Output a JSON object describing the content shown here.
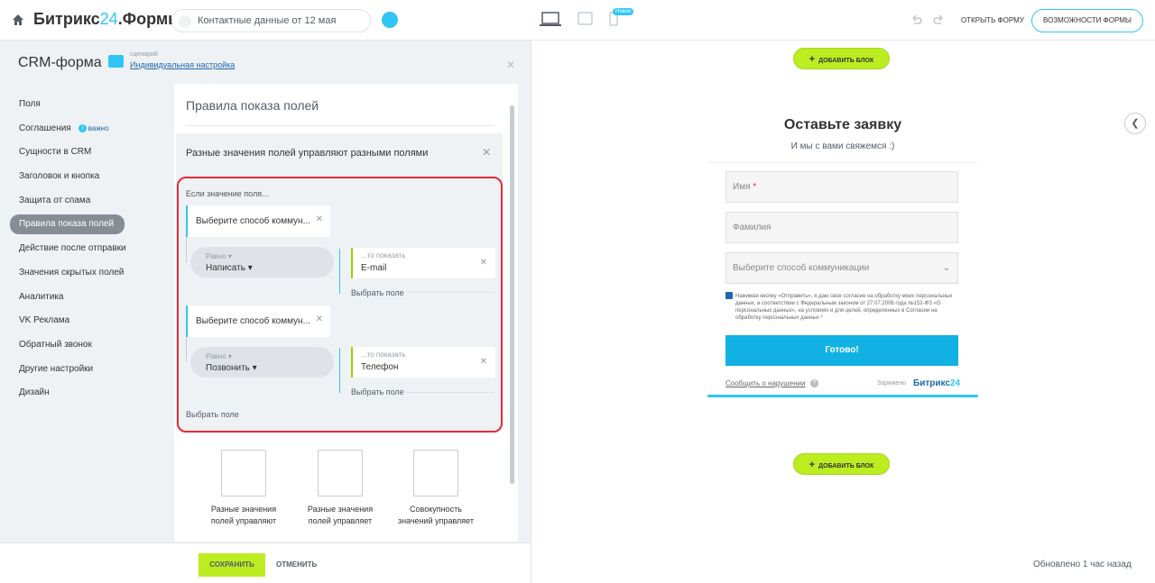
{
  "header": {
    "logo_main": "Битрикс",
    "logo_num": "24",
    "logo_suffix": ".Формы",
    "doc_name": "Контактные данные от 12 мая",
    "new_badge": "Новое",
    "open_form": "ОТКРЫТЬ ФОРМУ",
    "features": "ВОЗМОЖНОСТИ ФОРМЫ"
  },
  "sidebar": {
    "title": "CRM-форма",
    "scenario_label": "сценарий",
    "scenario_value": "Индивидуальная настройка",
    "items": [
      {
        "label": "Поля"
      },
      {
        "label": "Соглашения",
        "badge": "важно"
      },
      {
        "label": "Сущности в CRM"
      },
      {
        "label": "Заголовок и кнопка"
      },
      {
        "label": "Защита от спама"
      },
      {
        "label": "Правила показа полей",
        "active": true
      },
      {
        "label": "Действие после отправки"
      },
      {
        "label": "Значения скрытых полей"
      },
      {
        "label": "Аналитика"
      },
      {
        "label": "VK Реклама"
      },
      {
        "label": "Обратный звонок"
      },
      {
        "label": "Другие настройки"
      },
      {
        "label": "Дизайн"
      }
    ]
  },
  "rules": {
    "title": "Правила показа полей",
    "card_title": "Разные значения полей управляют разными полями",
    "condition_label": "Если значение поля...",
    "rules": [
      {
        "field": "Выберите способ коммун...",
        "eq_label": "Равно",
        "eq_value": "Написать",
        "show_label": "...то показать",
        "show_value": "E-mail",
        "pick": "Выбрать поле"
      },
      {
        "field": "Выберите способ коммун...",
        "eq_label": "Равно",
        "eq_value": "Позвонить",
        "show_label": "...то показать",
        "show_value": "Телефон",
        "pick": "Выбрать поле"
      }
    ],
    "pick_field": "Выбрать поле",
    "options": [
      {
        "line1": "Разные значения",
        "line2": "полей управляют"
      },
      {
        "line1": "Разные значения",
        "line2": "полей управляет"
      },
      {
        "line1": "Совокупность",
        "line2": "значений управляет"
      }
    ]
  },
  "footer": {
    "save": "СОХРАНИТЬ",
    "cancel": "ОТМЕНИТЬ"
  },
  "preview": {
    "add_block": "ДОБАВИТЬ БЛОК",
    "form_title": "Оставьте заявку",
    "form_sub": "И мы с вами свяжемся :)",
    "name_placeholder": "Имя",
    "surname_placeholder": "Фамилия",
    "select_placeholder": "Выберите способ коммуникации",
    "consent": "Нажимая кнопку «Отправить», я даю свое согласие на обработку моих персональных данных, в соответствии с Федеральным законом от 27.07.2006 года №152-ФЗ «О персональных данных», на условиях и для целей, определенных в Согласии на обработку персональных данных",
    "submit": "Готово!",
    "report": "Сообщить о нарушении",
    "charged": "Заряжено",
    "brand": "Битрикс",
    "brand_num": "24",
    "updated": "Обновлено 1 час назад"
  },
  "colors": {
    "accent": "#2fc6f6",
    "green": "#bbed21",
    "highlight": "#e52a3a",
    "submit": "#12b1e3"
  }
}
